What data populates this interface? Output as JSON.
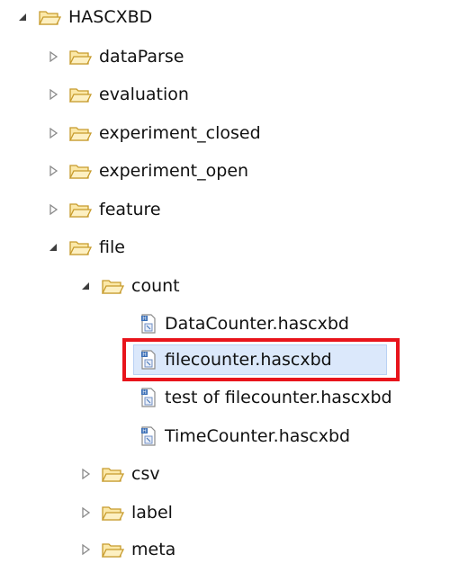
{
  "tree": {
    "root": {
      "label": "HASCXBD",
      "expanded": true
    },
    "items": [
      {
        "label": "dataParse",
        "kind": "folder",
        "expanded": false
      },
      {
        "label": "evaluation",
        "kind": "folder",
        "expanded": false
      },
      {
        "label": "experiment_closed",
        "kind": "folder",
        "expanded": false
      },
      {
        "label": "experiment_open",
        "kind": "folder",
        "expanded": false
      },
      {
        "label": "feature",
        "kind": "folder",
        "expanded": false
      },
      {
        "label": "file",
        "kind": "folder",
        "expanded": true
      },
      {
        "label": "count",
        "kind": "folder",
        "expanded": true
      },
      {
        "label": "DataCounter.hascxbd",
        "kind": "file"
      },
      {
        "label": "filecounter.hascxbd",
        "kind": "file",
        "selected": true,
        "highlighted": true
      },
      {
        "label": "test of filecounter.hascxbd",
        "kind": "file"
      },
      {
        "label": "TimeCounter.hascxbd",
        "kind": "file"
      },
      {
        "label": "csv",
        "kind": "folder",
        "expanded": false
      },
      {
        "label": "label",
        "kind": "folder",
        "expanded": false
      },
      {
        "label": "meta",
        "kind": "folder",
        "expanded": false
      }
    ]
  },
  "colors": {
    "folder_fill": "#fbe8a8",
    "folder_stroke": "#c79b2c",
    "file_icon_blue": "#3b6fb6",
    "selection": "#dbe8fb",
    "highlight": "#e8141b"
  },
  "icons": {
    "expanded": "triangle-down-icon",
    "collapsed": "triangle-right-icon",
    "folder": "open-folder-icon",
    "file": "hascxbd-file-icon"
  }
}
